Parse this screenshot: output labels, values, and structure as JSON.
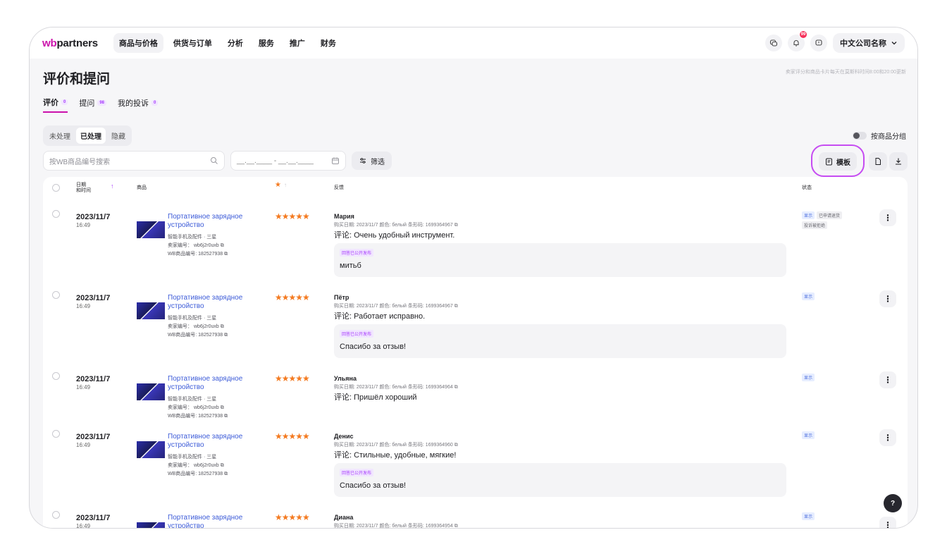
{
  "logo": {
    "wb": "wb",
    "rest": "partners"
  },
  "nav": [
    "商品与价格",
    "供货与订单",
    "分析",
    "服务",
    "推广",
    "财务"
  ],
  "header": {
    "notif_count": "99",
    "company": "中文公司名称"
  },
  "update_note": "卖家评分和商品卡片每天在莫斯科时间8:00和20:00更新",
  "page_title": "评价和提问",
  "tabs": [
    {
      "label": "评价",
      "count": "0"
    },
    {
      "label": "提问",
      "count": "98"
    },
    {
      "label": "我的投诉",
      "count": "0"
    }
  ],
  "segments": [
    "未处理",
    "已处理",
    "隐藏"
  ],
  "group_toggle": "按商品分组",
  "search": {
    "placeholder": "按WB商品编号搜索"
  },
  "date_range": {
    "placeholder": "__.__.____ - __.__.____"
  },
  "filter_label": "筛选",
  "template_label": "模板",
  "columns": {
    "date": "日期",
    "date2": "和时间",
    "product": "商品",
    "feedback": "反馈",
    "status": "状态"
  },
  "product": {
    "name": "Портативное зарядное устройство",
    "category": "智能手机及配件 · 三星",
    "seller_sku": "卖家编号： wb6j2r0uxb",
    "wb_sku": "WB商品编号: 182527938"
  },
  "stars": "★★★★★",
  "reply_tag": "回答已公开发布",
  "rows": [
    {
      "date": "2023/11/7",
      "time": "16:49",
      "author": "Мария",
      "meta": "购买日期: 2023/11/7   颜色: белый   条形码: 1699364967",
      "comment": "评论: Очень удобный инструмент.",
      "reply": "митьб",
      "status": [
        "显示",
        "已申请退货",
        "投诉被拒绝"
      ]
    },
    {
      "date": "2023/11/7",
      "time": "16:49",
      "author": "Пётр",
      "meta": "购买日期: 2023/11/7   颜色: белый   条形码: 1699364967",
      "comment": "评论: Работает исправно.",
      "reply": "Спасибо за отзыв!",
      "status": [
        "显示"
      ]
    },
    {
      "date": "2023/11/7",
      "time": "16:49",
      "author": "Ульяна",
      "meta": "购买日期: 2023/11/7   颜色: белый   条形码: 1699364964",
      "comment": "评论: Пришёл хороший",
      "reply": "",
      "status": [
        "显示"
      ]
    },
    {
      "date": "2023/11/7",
      "time": "16:49",
      "author": "Денис",
      "meta": "购买日期: 2023/11/7   颜色: белый   条形码: 1699364960",
      "comment": "评论: Стильные, удобные, мягкие!",
      "reply": "Спасибо за отзыв!",
      "status": [
        "显示"
      ]
    },
    {
      "date": "2023/11/7",
      "time": "16:49",
      "author": "Диана",
      "meta": "购买日期: 2023/11/7   颜色: белый   条形码: 1699364954",
      "comment": "",
      "reply": "",
      "status": [
        "显示"
      ]
    }
  ],
  "help_label": "?"
}
